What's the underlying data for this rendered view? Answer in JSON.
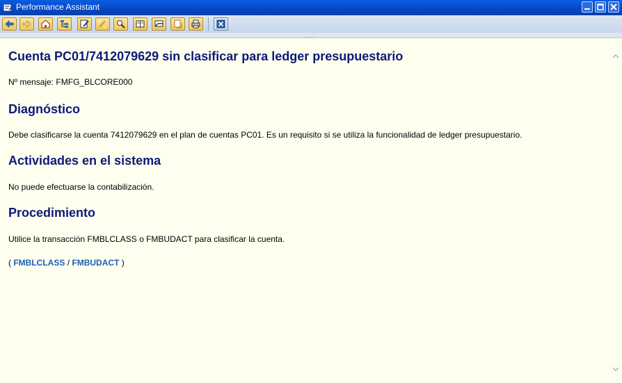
{
  "window": {
    "title": "Performance Assistant"
  },
  "toolbar": {
    "buttons": [
      "back-icon",
      "forward-icon",
      "home-icon",
      "structure-icon",
      "edit-icon",
      "highlight-icon",
      "find-icon",
      "book-icon",
      "bookmark-icon",
      "copy-icon",
      "print-icon",
      "close-window-icon"
    ]
  },
  "message": {
    "title": "Cuenta PC01/7412079629 sin clasificar para ledger presupuestario",
    "number_line": "Nº mensaje: FMFG_BLCORE000",
    "sections": [
      {
        "heading": "Diagnóstico",
        "text": "Debe clasificarse la cuenta 7412079629 en el plan de cuentas PC01. Es un requisito si se utiliza la funcionalidad de ledger presupuestario."
      },
      {
        "heading": "Actividades en el sistema",
        "text": "No puede efectuarse la contabilización."
      },
      {
        "heading": "Procedimiento",
        "text": "Utilice la transacción FMBLCLASS o FMBUDACT para clasificar la cuenta."
      }
    ],
    "links": {
      "open": "(",
      "link1": "FMBLCLASS",
      "separator": "/",
      "link2": "FMBUDACT",
      "close": ")"
    }
  }
}
